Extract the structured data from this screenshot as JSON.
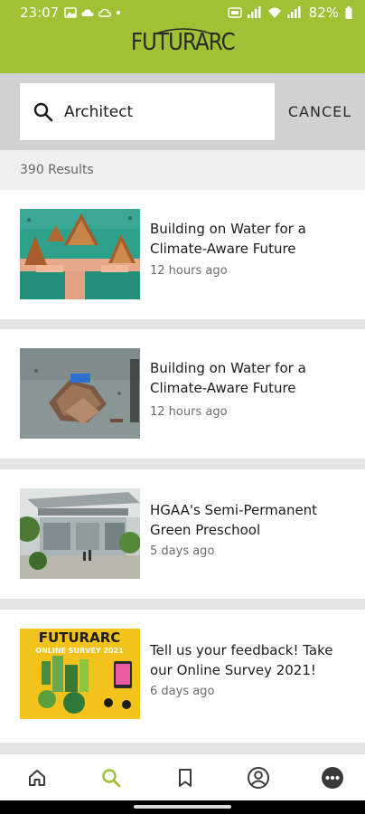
{
  "status_bar": {
    "time": "23:07",
    "battery": "82%"
  },
  "app": {
    "logo_text": "FUTURARC",
    "brand_color": "#9ec233"
  },
  "search": {
    "query": "Architect",
    "placeholder": "Search",
    "cancel_label": "CANCEL"
  },
  "results": {
    "count_label": "390 Results",
    "items": [
      {
        "title": "Building on Water for a Climate-Aware Future",
        "time": "12 hours ago",
        "thumb": "floating-houses-image"
      },
      {
        "title": "Building on Water for a Climate-Aware Future",
        "time": "12 hours ago",
        "thumb": "debris-on-water-image"
      },
      {
        "title": "HGAA's Semi-Permanent Green Preschool",
        "time": "5 days ago",
        "thumb": "green-preschool-image"
      },
      {
        "title": "Tell us your feedback! Take our Online Survey 2021!",
        "time": "6 days ago",
        "thumb": "online-survey-poster-image"
      }
    ]
  },
  "bottom_nav": {
    "items": [
      "home-icon",
      "search-icon",
      "bookmark-icon",
      "profile-icon",
      "more-icon"
    ],
    "active": "search-icon",
    "active_color": "#9ec233",
    "inactive_color": "#3a3a3a"
  },
  "thumb_texts": {
    "survey_brand": "FUTURARC",
    "survey_title": "ONLINE SURVEY 2021"
  }
}
